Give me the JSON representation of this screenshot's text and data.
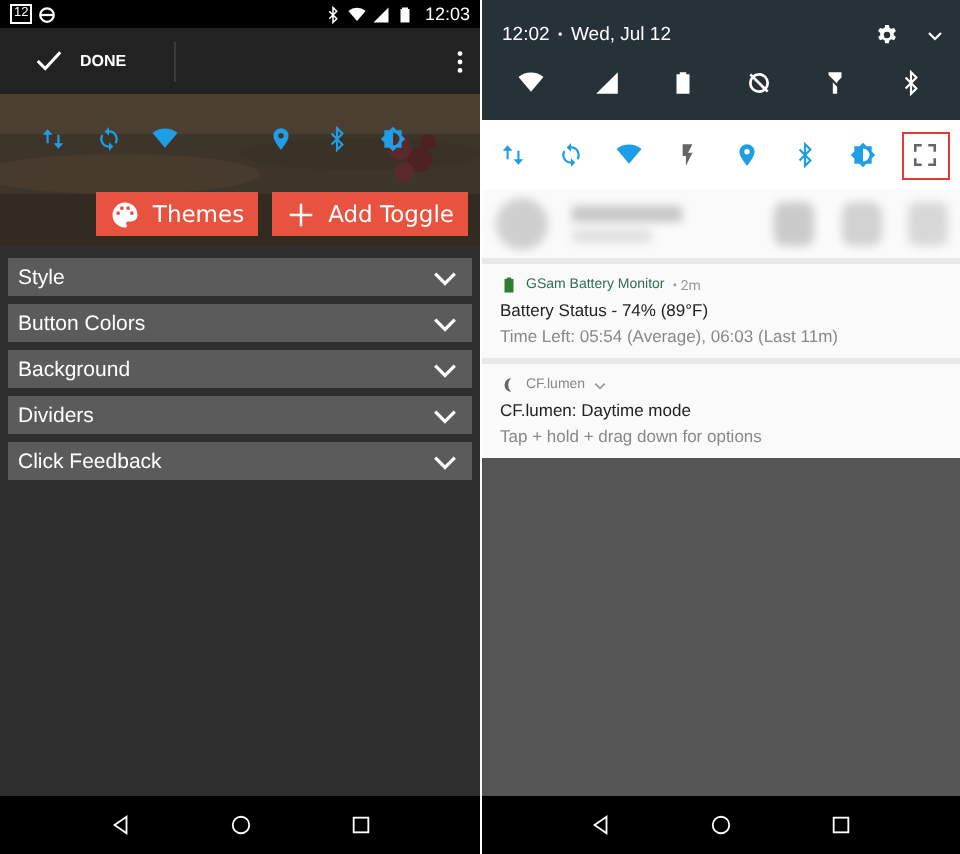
{
  "left_screen": {
    "status_bar": {
      "calendar_day": "12",
      "time": "12:03"
    },
    "action_bar": {
      "done_label": "DONE"
    },
    "toggles": [
      {
        "kind": "data",
        "gap_before": false
      },
      {
        "kind": "sync",
        "gap_before": false
      },
      {
        "kind": "wifi",
        "gap_before": false
      },
      {
        "kind": "location",
        "gap_before": true
      },
      {
        "kind": "bluetooth",
        "gap_before": false
      },
      {
        "kind": "brightness",
        "gap_before": false
      }
    ],
    "buttons": [
      {
        "kind": "palette",
        "label": "Themes"
      },
      {
        "kind": "plus",
        "label": "Add Toggle"
      }
    ],
    "sections": [
      {
        "label": "Style",
        "expanded": false
      },
      {
        "label": "Button Colors",
        "expanded": false
      },
      {
        "label": "Background",
        "expanded": false
      },
      {
        "label": "Dividers",
        "expanded": false
      },
      {
        "label": "Click Feedback",
        "expanded": false
      }
    ]
  },
  "right_screen": {
    "header": {
      "time": "12:02",
      "separator": "•",
      "date": "Wed, Jul 12"
    },
    "top_tiles": [
      {
        "kind": "wifi"
      },
      {
        "kind": "signal"
      },
      {
        "kind": "battery"
      },
      {
        "kind": "nosync"
      },
      {
        "kind": "flashlight"
      },
      {
        "kind": "bluetooth"
      }
    ],
    "toggles": [
      {
        "kind": "data",
        "highlighted": false
      },
      {
        "kind": "sync",
        "highlighted": false
      },
      {
        "kind": "wifi",
        "highlighted": false
      },
      {
        "kind": "flash",
        "highlighted": false
      },
      {
        "kind": "location",
        "highlighted": false
      },
      {
        "kind": "bluetooth",
        "highlighted": false
      },
      {
        "kind": "brightness",
        "highlighted": false
      },
      {
        "kind": "fullscreen",
        "highlighted": true
      }
    ],
    "notifications": [
      {
        "kind": "battery",
        "app": "GSam Battery Monitor",
        "age": "• 2m",
        "title": "Battery Status - 74% (89°F)",
        "text": "Time Left: 05:54 (Average), 06:03 (Last 11m)"
      },
      {
        "kind": "moon",
        "app": "CF.lumen",
        "title": "CF.lumen: Daytime mode",
        "text": "Tap + hold + drag down for options"
      }
    ]
  }
}
